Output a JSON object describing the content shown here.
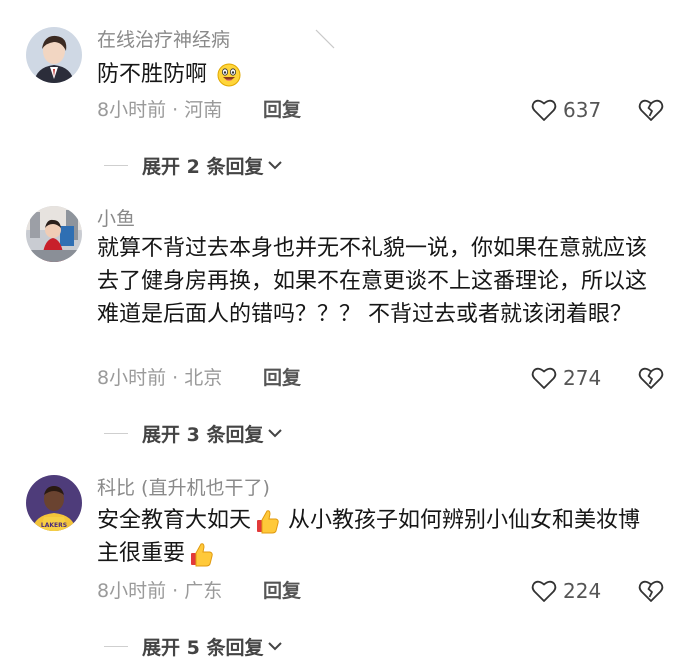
{
  "comments": [
    {
      "username": "在线治疗神经病",
      "text": "防不胜防啊",
      "meta": "8小时前 · 河南",
      "reply_label": "回复",
      "likes": "637",
      "expand_label": "展开 2 条回复",
      "avatar_icon": "avatar-young-man-in-suit",
      "emoji": [
        "grinning-face-emoji"
      ]
    },
    {
      "username": "小鱼",
      "text": "就算不背过去本身也并无不礼貌一说，你如果在意就应该去了健身房再换，如果不在意更谈不上这番理论，所以这难道是后面人的错吗？？？ 不背过去或者就该闭着眼？",
      "meta": "8小时前 · 北京",
      "reply_label": "回复",
      "likes": "274",
      "expand_label": "展开 3 条回复",
      "avatar_icon": "avatar-person-outdoors"
    },
    {
      "username": "科比 (直升机也干了)",
      "text_part1": "安全教育大如天",
      "text_part2": " 从小教孩子如何辨别小仙女和美妆博主很重要",
      "meta": "8小时前 · 广东",
      "reply_label": "回复",
      "likes": "224",
      "expand_label": "展开 5 条回复",
      "avatar_icon": "avatar-basketball-player",
      "emoji": [
        "thumbs-up-emoji",
        "thumbs-up-emoji"
      ]
    }
  ],
  "colors": {
    "username": "#8a8a8a",
    "body": "#161616",
    "meta": "#9a9a9a"
  }
}
